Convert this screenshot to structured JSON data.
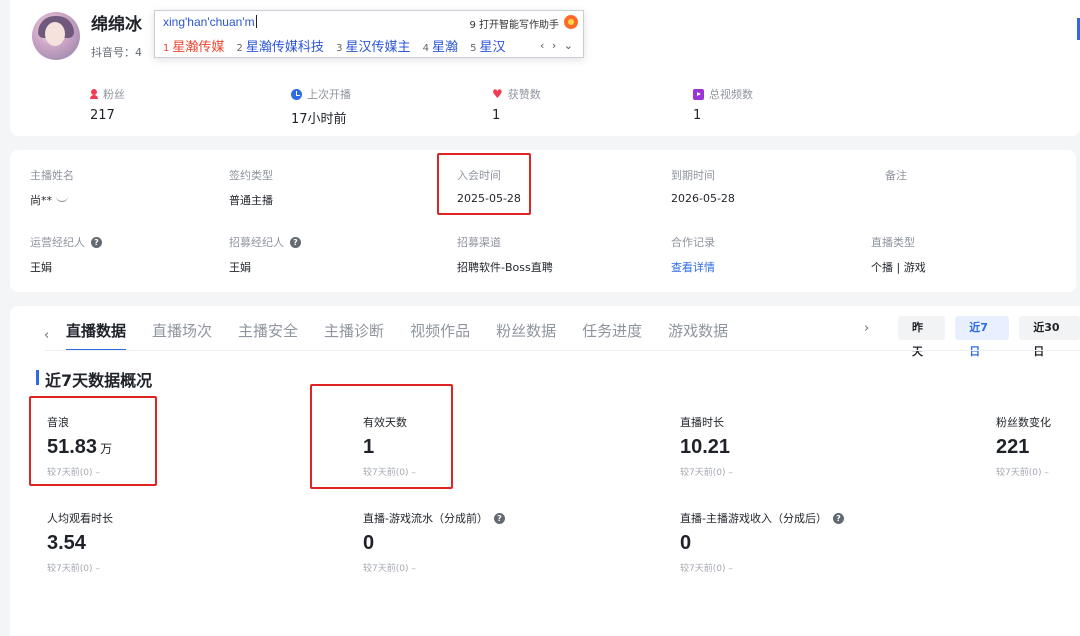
{
  "profile": {
    "nickname": "绵绵冰",
    "douyin_id": "抖音号：4"
  },
  "ime": {
    "pinyin": "xing'han'chuan'm",
    "helper": "9 打开智能写作助手",
    "candidates": [
      {
        "num": "1",
        "text": "星瀚传媒"
      },
      {
        "num": "2",
        "text": "星瀚传媒科技"
      },
      {
        "num": "3",
        "text": "星汉传媒主"
      },
      {
        "num": "4",
        "text": "星瀚"
      },
      {
        "num": "5",
        "text": "星汉"
      }
    ],
    "nav": "‹ › ⌄"
  },
  "stats": [
    {
      "label": "粉丝",
      "value": "217",
      "icon": "fans-icon"
    },
    {
      "label": "上次开播",
      "value": "17小时前",
      "icon": "clock-icon"
    },
    {
      "label": "获赞数",
      "value": "1",
      "icon": "heart-icon"
    },
    {
      "label": "总视频数",
      "value": "1",
      "icon": "video-icon"
    }
  ],
  "info": {
    "row1": [
      {
        "key": "主播姓名",
        "value": "尚**"
      },
      {
        "key": "签约类型",
        "value": "普通主播"
      },
      {
        "key": "入会时间",
        "value": "2025-05-28"
      },
      {
        "key": "到期时间",
        "value": "2026-05-28"
      },
      {
        "key": "备注",
        "value": ""
      }
    ],
    "row2": [
      {
        "key": "运营经纪人",
        "value": "王娟"
      },
      {
        "key": "招募经纪人",
        "value": "王娟"
      },
      {
        "key": "招募渠道",
        "value": "招聘软件-Boss直聘"
      },
      {
        "key": "合作记录",
        "value": "查看详情"
      },
      {
        "key": "直播类型",
        "value": "个播 | 游戏"
      }
    ]
  },
  "tabs": {
    "left_arrow": "‹",
    "right_arrow": "›",
    "items": [
      "直播数据",
      "直播场次",
      "主播安全",
      "主播诊断",
      "视频作品",
      "粉丝数据",
      "任务进度",
      "游戏数据"
    ],
    "active_index": 0,
    "ranges": [
      "昨天",
      "近7日",
      "近30日"
    ],
    "active_range": 1
  },
  "overview": {
    "title": "近7天数据概况",
    "metrics": [
      {
        "label": "音浪",
        "value": "51.83",
        "unit": "万",
        "compare": "较7天前(0) –"
      },
      {
        "label": "有效天数",
        "value": "1",
        "unit": "",
        "compare": "较7天前(0) –"
      },
      {
        "label": "直播时长",
        "value": "10.21",
        "unit": "",
        "compare": "较7天前(0) –"
      },
      {
        "label": "粉丝数变化",
        "value": "221",
        "unit": "",
        "compare": "较7天前(0) –"
      },
      {
        "label": "人均观看时长",
        "value": "3.54",
        "unit": "",
        "compare": "较7天前(0) –"
      },
      {
        "label": "直播-游戏流水（分成前）",
        "value": "0",
        "unit": "",
        "compare": "较7天前(0) –"
      },
      {
        "label": "直播-主播游戏收入（分成后）",
        "value": "0",
        "unit": "",
        "compare": "较7天前(0) –"
      }
    ]
  }
}
